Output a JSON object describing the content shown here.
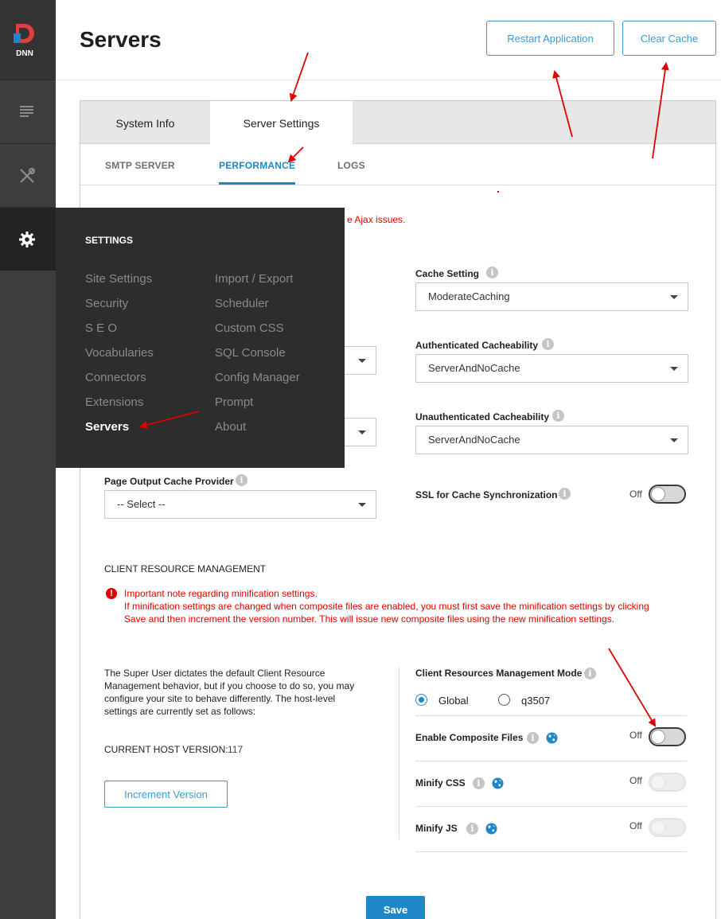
{
  "page": {
    "title": "Servers"
  },
  "header": {
    "restart_label": "Restart Application",
    "clear_cache_label": "Clear Cache"
  },
  "rail": {
    "logo_text": "DNN",
    "items": [
      {
        "icon": "content-icon"
      },
      {
        "icon": "tools-icon"
      },
      {
        "icon": "gear-icon",
        "active": true
      }
    ]
  },
  "tabs": [
    {
      "label": "System Info",
      "active": false
    },
    {
      "label": "Server Settings",
      "active": true
    }
  ],
  "subtabs": [
    {
      "label": "SMTP SERVER",
      "active": false
    },
    {
      "label": "PERFORMANCE",
      "active": true
    },
    {
      "label": "LOGS",
      "active": false
    }
  ],
  "partial_warning": "e Ajax issues.",
  "cache": {
    "cache_setting_label": "Cache Setting",
    "cache_setting_value": "ModerateCaching",
    "auth_label": "Authenticated Cacheability",
    "auth_value": "ServerAndNoCache",
    "unauth_label": "Unauthenticated Cacheability",
    "unauth_value": "ServerAndNoCache",
    "page_output_label": "Page Output Cache Provider",
    "page_output_value": "-- Select --",
    "ssl_label": "SSL for Cache Synchronization",
    "ssl_state": "Off"
  },
  "crm": {
    "section_title": "CLIENT RESOURCE MANAGEMENT",
    "note_title": "Important note regarding minification settings.",
    "note_line1": "If minification settings are changed when composite files are enabled, you must first save the minification settings by clicking",
    "note_line2": "Save and then increment the version number. This will issue new composite files using the new minification settings.",
    "desc_line1": "The Super User dictates the default Client Resource",
    "desc_line2": "Management behavior, but if you choose to do so, you may",
    "desc_line3": "configure your site to behave differently. The host-level",
    "desc_line4": "settings are currently set as follows:",
    "host_version_label": "CURRENT HOST VERSION:",
    "host_version_value": "117",
    "increment_label": "Increment Version",
    "mode_label": "Client Resources Management Mode",
    "mode_options": [
      "Global",
      "q3507"
    ],
    "mode_selected": "Global",
    "composite_label": "Enable Composite Files",
    "composite_state": "Off",
    "minify_css_label": "Minify CSS",
    "minify_css_state": "Off",
    "minify_js_label": "Minify JS",
    "minify_js_state": "Off"
  },
  "save_label": "Save",
  "flyout": {
    "title": "SETTINGS",
    "left_items": [
      "Site Settings",
      "Security",
      "S E O",
      "Vocabularies",
      "Connectors",
      "Extensions",
      "Servers"
    ],
    "right_items": [
      "Import / Export",
      "Scheduler",
      "Custom CSS",
      "SQL Console",
      "Config Manager",
      "Prompt",
      "About"
    ],
    "active_item": "Servers"
  },
  "colors": {
    "accent": "#1e88c7",
    "error": "#e00000",
    "rail": "#3d3d3d",
    "flyout": "#2d2d2d"
  }
}
